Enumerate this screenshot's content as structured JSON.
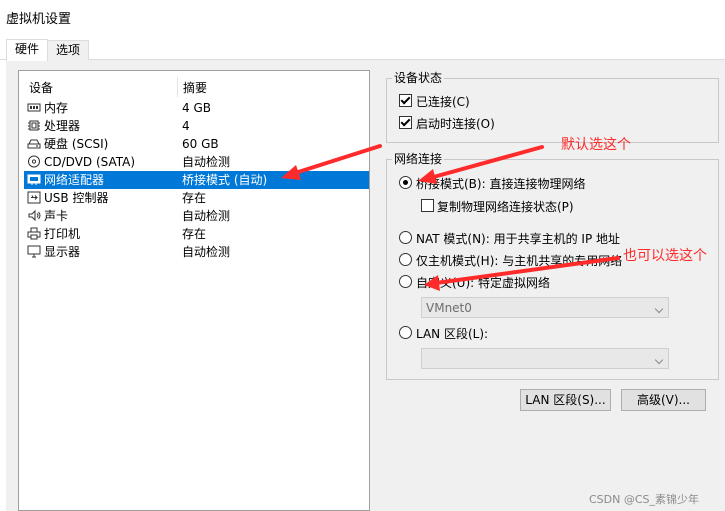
{
  "window": {
    "title": "虚拟机设置"
  },
  "tabs": [
    {
      "label": "硬件",
      "active": true
    },
    {
      "label": "选项",
      "active": false
    }
  ],
  "device_list": {
    "col_device": "设备",
    "col_summary": "摘要",
    "items": [
      {
        "name": "内存",
        "summary": "4 GB",
        "icon": "memory-icon"
      },
      {
        "name": "处理器",
        "summary": "4",
        "icon": "cpu-icon"
      },
      {
        "name": "硬盘 (SCSI)",
        "summary": "60 GB",
        "icon": "hard-disk-icon"
      },
      {
        "name": "CD/DVD (SATA)",
        "summary": "自动检测",
        "icon": "cd-dvd-icon"
      },
      {
        "name": "网络适配器",
        "summary": "桥接模式 (自动)",
        "icon": "network-adapter-icon",
        "selected": true
      },
      {
        "name": "USB 控制器",
        "summary": "存在",
        "icon": "usb-icon"
      },
      {
        "name": "声卡",
        "summary": "自动检测",
        "icon": "speaker-icon"
      },
      {
        "name": "打印机",
        "summary": "存在",
        "icon": "printer-icon"
      },
      {
        "name": "显示器",
        "summary": "自动检测",
        "icon": "monitor-icon"
      }
    ]
  },
  "device_status": {
    "title": "设备状态",
    "connected": {
      "label": "已连接(C)",
      "checked": true
    },
    "connect_at_poweron": {
      "label": "启动时连接(O)",
      "checked": true
    }
  },
  "network_connection": {
    "title": "网络连接",
    "bridged": {
      "label": "桥接模式(B): 直接连接物理网络",
      "checked": true
    },
    "replicate": {
      "label": "复制物理网络连接状态(P)",
      "checked": false
    },
    "nat": {
      "label": "NAT 模式(N): 用于共享主机的 IP 地址",
      "checked": false
    },
    "host_only": {
      "label": "仅主机模式(H): 与主机共享的专用网络",
      "checked": false
    },
    "custom": {
      "label": "自定义(U): 特定虚拟网络",
      "checked": false
    },
    "vmnet_value": "VMnet0",
    "lan": {
      "label": "LAN 区段(L):",
      "checked": false
    },
    "lan_value": ""
  },
  "buttons": {
    "lan_segments": "LAN 区段(S)...",
    "advanced": "高级(V)..."
  },
  "annotations": {
    "default_note": "默认选这个",
    "alt_note": "也可以选这个",
    "color": "#ff2a2a"
  },
  "watermark": "CSDN @CS_素锦少年"
}
